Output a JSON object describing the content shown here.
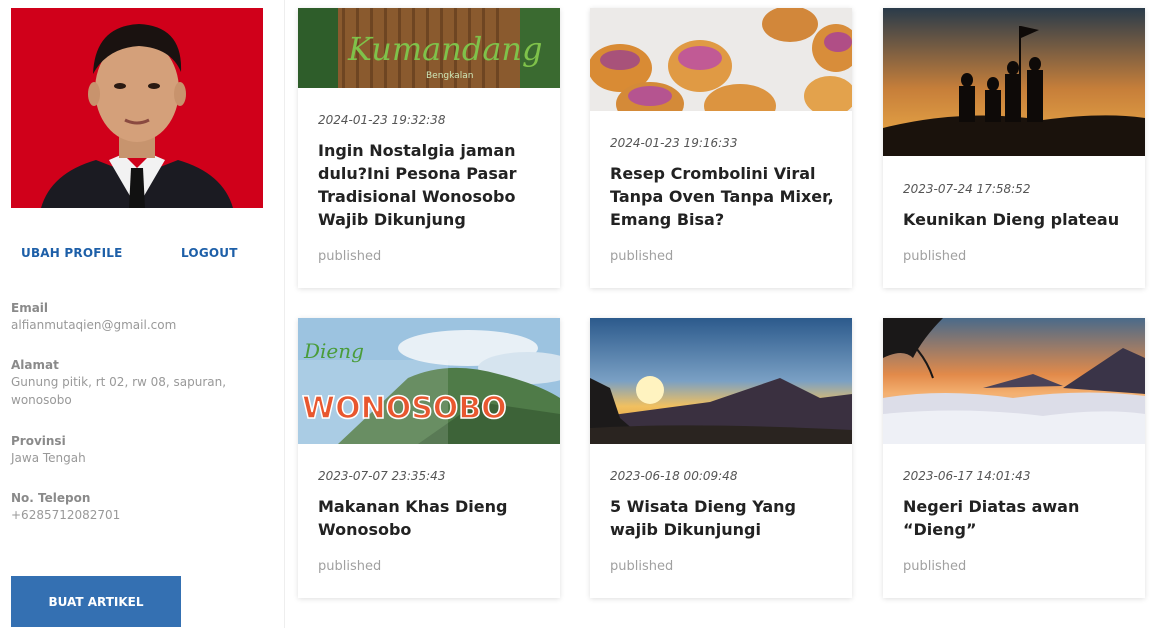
{
  "profile": {
    "edit_label": "UBAH PROFILE",
    "logout_label": "LOGOUT",
    "email_label": "Email",
    "email": "alfianmutaqien@gmail.com",
    "address_label": "Alamat",
    "address": "Gunung pitik, rt 02, rw 08, sapuran, wonosobo",
    "province_label": "Provinsi",
    "province": "Jawa Tengah",
    "phone_label": "No. Telepon",
    "phone": "+6285712082701",
    "create_label": "BUAT ARTIKEL"
  },
  "articles": [
    {
      "date": "2024-01-23 19:32:38",
      "title": "Ingin Nostalgia jaman dulu?Ini Pesona Pasar Tradisional Wonosobo Wajib Dikunjung",
      "status": "published",
      "image_text": "Kumandang",
      "image_subtext": "Bengkalan"
    },
    {
      "date": "2024-01-23 19:16:33",
      "title": "Resep Crombolini Viral Tanpa Oven Tanpa Mixer, Emang Bisa?",
      "status": "published"
    },
    {
      "date": "2023-07-24 17:58:52",
      "title": "Keunikan Dieng plateau",
      "status": "published"
    },
    {
      "date": "2023-07-07 23:35:43",
      "title": "Makanan Khas Dieng Wonosobo",
      "status": "published",
      "image_text": "WONOSOBO",
      "image_subtext": "Dieng"
    },
    {
      "date": "2023-06-18 00:09:48",
      "title": "5 Wisata Dieng Yang wajib Dikunjungi",
      "status": "published"
    },
    {
      "date": "2023-06-17 14:01:43",
      "title": "Negeri Diatas awan “Dieng”",
      "status": "published"
    }
  ]
}
